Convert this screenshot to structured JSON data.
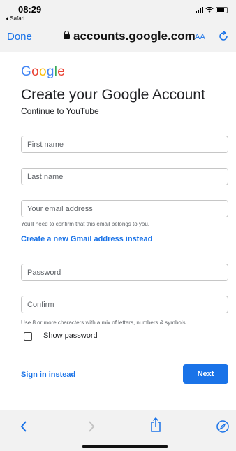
{
  "status_bar": {
    "time": "08:29",
    "back_app": "◂ Safari"
  },
  "url_bar": {
    "done_label": "Done",
    "url": "accounts.google.com",
    "text_size_label": "AA"
  },
  "page": {
    "logo_letters": [
      {
        "char": "G",
        "color": "#4285F4"
      },
      {
        "char": "o",
        "color": "#EA4335"
      },
      {
        "char": "o",
        "color": "#FBBC05"
      },
      {
        "char": "g",
        "color": "#4285F4"
      },
      {
        "char": "l",
        "color": "#34A853"
      },
      {
        "char": "e",
        "color": "#EA4335"
      }
    ],
    "title": "Create your Google Account",
    "subtitle": "Continue to YouTube",
    "first_name_placeholder": "First name",
    "last_name_placeholder": "Last name",
    "email_placeholder": "Your email address",
    "email_helper": "You'll need to confirm that this email belongs to you.",
    "gmail_link": "Create a new Gmail address instead",
    "password_placeholder": "Password",
    "confirm_placeholder": "Confirm",
    "password_helper": "Use 8 or more characters with a mix of letters, numbers & symbols",
    "show_password_label": "Show password",
    "sign_in_link": "Sign in instead",
    "next_label": "Next"
  },
  "colors": {
    "accent": "#1a73e8",
    "chrome": "#f2f2f2"
  },
  "toolbar": {
    "icons": [
      "back-icon",
      "forward-icon",
      "share-icon",
      "compass-icon"
    ]
  }
}
